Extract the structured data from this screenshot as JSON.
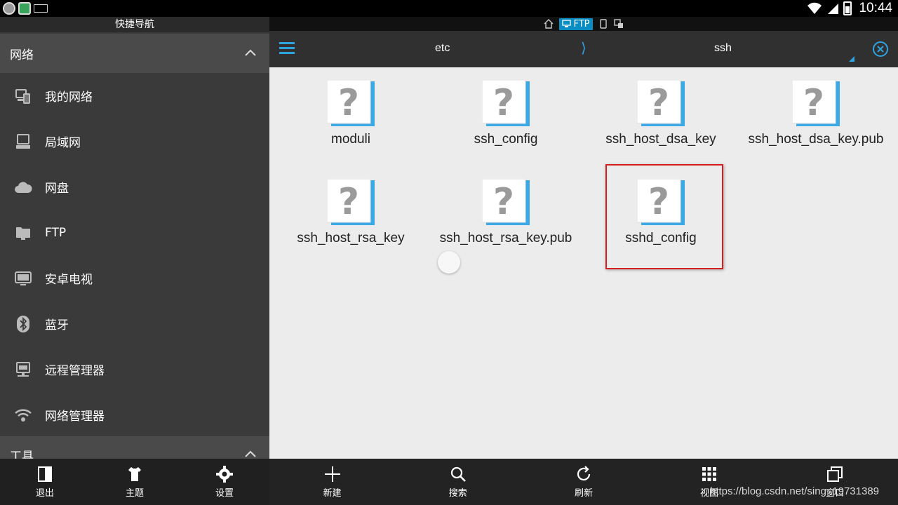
{
  "status_bar": {
    "time": "10:44",
    "icons": [
      "notification-icon",
      "app-store-icon",
      "keyboard-icon",
      "wifi-icon",
      "signal-icon",
      "battery-icon"
    ]
  },
  "drawer": {
    "title": "快捷导航",
    "section_network": "网络",
    "items": [
      {
        "label": "我的网络",
        "icon": "my-network-icon"
      },
      {
        "label": "局域网",
        "icon": "lan-icon"
      },
      {
        "label": "网盘",
        "icon": "cloud-icon"
      },
      {
        "label": "FTP",
        "icon": "ftp-folder-icon"
      },
      {
        "label": "安卓电视",
        "icon": "tv-icon"
      },
      {
        "label": "蓝牙",
        "icon": "bluetooth-icon"
      },
      {
        "label": "远程管理器",
        "icon": "remote-ftp-icon"
      },
      {
        "label": "网络管理器",
        "icon": "wifi-manager-icon"
      }
    ],
    "section_tools": "工具",
    "bottom_buttons": [
      {
        "label": "退出",
        "icon": "exit-icon"
      },
      {
        "label": "主题",
        "icon": "shirt-icon"
      },
      {
        "label": "设置",
        "icon": "gear-icon"
      }
    ]
  },
  "tabstrip": {
    "active_tab": "FTP",
    "tabs": [
      "home-icon",
      "ftp-icon",
      "phone-icon",
      "multi-window-icon"
    ]
  },
  "header": {
    "crumb_parent": "etc",
    "crumb_separator": "⟩",
    "crumb_current": "ssh"
  },
  "files": [
    {
      "name": "moduli"
    },
    {
      "name": "ssh_config"
    },
    {
      "name": "ssh_host_dsa_key"
    },
    {
      "name": "ssh_host_dsa_key.pub"
    },
    {
      "name": "ssh_host_rsa_key"
    },
    {
      "name": "ssh_host_rsa_key.pub"
    },
    {
      "name": "sshd_config"
    }
  ],
  "toolbar": [
    {
      "label": "新建",
      "icon": "plus-icon"
    },
    {
      "label": "搜索",
      "icon": "search-icon"
    },
    {
      "label": "刷新",
      "icon": "refresh-icon"
    },
    {
      "label": "视图",
      "icon": "grid-view-icon"
    },
    {
      "label": "窗口",
      "icon": "windows-icon"
    }
  ],
  "watermark": "https://blog.csdn.net/sing_19731389",
  "colors": {
    "accent": "#2fa3e0",
    "ftp_tab": "#0a8dc3",
    "highlight": "#d42020",
    "drawer_bg": "#3a3a3a"
  }
}
